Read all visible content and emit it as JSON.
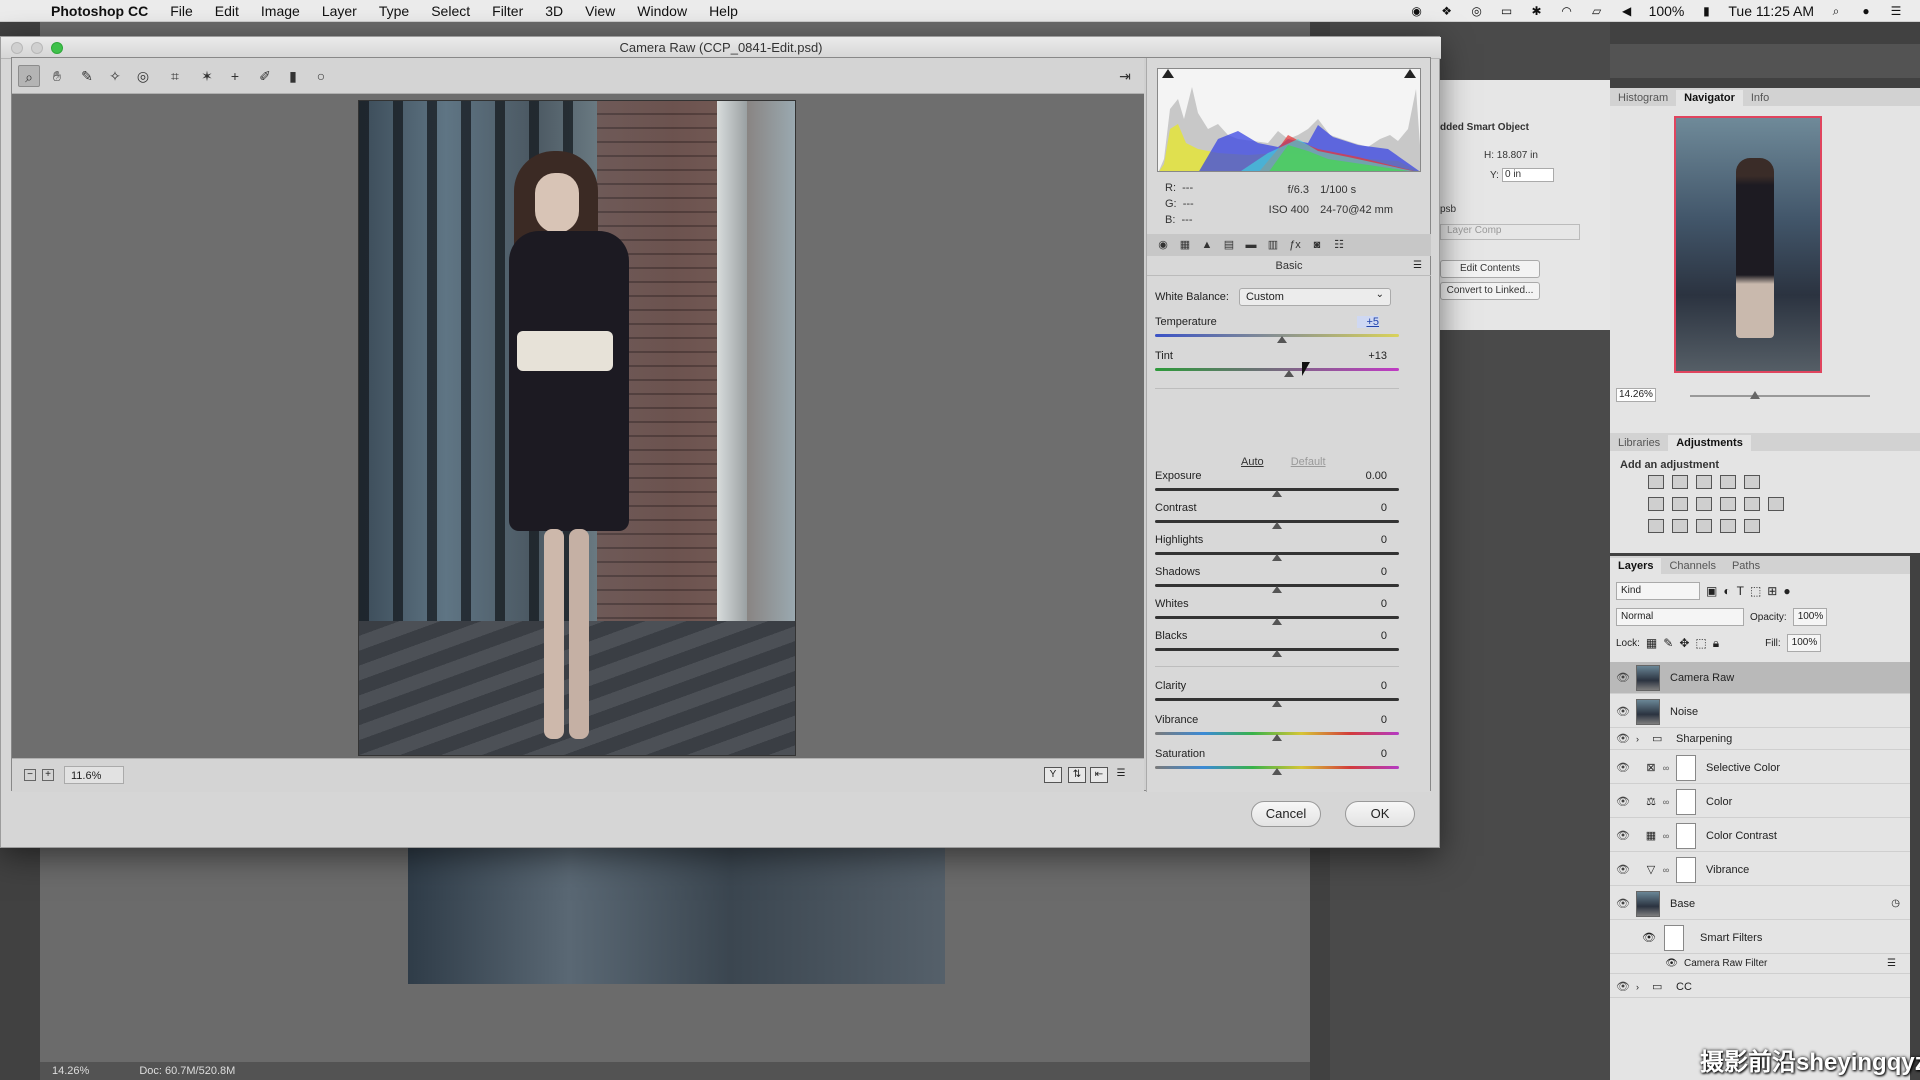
{
  "menubar": {
    "app_name": "Photoshop CC",
    "items": [
      "File",
      "Edit",
      "Image",
      "Layer",
      "Type",
      "Select",
      "Filter",
      "3D",
      "View",
      "Window",
      "Help"
    ],
    "battery": "100%",
    "clock": "Tue 11:25 AM"
  },
  "dialog": {
    "title": "Camera Raw (CCP_0841-Edit.psd)",
    "zoom": "11.6%",
    "histogram": {
      "r": "---",
      "g": "---",
      "b": "---",
      "aperture": "f/6.3",
      "shutter": "1/100 s",
      "iso": "ISO 400",
      "lens": "24-70@42 mm"
    },
    "panel_name": "Basic",
    "white_balance": {
      "label": "White Balance:",
      "value": "Custom"
    },
    "sliders": [
      {
        "label": "Temperature",
        "value": "+5",
        "fraction": 0.52
      },
      {
        "label": "Tint",
        "value": "+13",
        "fraction": 0.55
      },
      {
        "label": "Exposure",
        "value": "0.00",
        "fraction": 0.5
      },
      {
        "label": "Contrast",
        "value": "0",
        "fraction": 0.5
      },
      {
        "label": "Highlights",
        "value": "0",
        "fraction": 0.5
      },
      {
        "label": "Shadows",
        "value": "0",
        "fraction": 0.5
      },
      {
        "label": "Whites",
        "value": "0",
        "fraction": 0.5
      },
      {
        "label": "Blacks",
        "value": "0",
        "fraction": 0.5
      },
      {
        "label": "Clarity",
        "value": "0",
        "fraction": 0.5
      },
      {
        "label": "Vibrance",
        "value": "0",
        "fraction": 0.5
      },
      {
        "label": "Saturation",
        "value": "0",
        "fraction": 0.5
      }
    ],
    "auto_label": "Auto",
    "default_label": "Default",
    "cancel_label": "Cancel",
    "ok_label": "OK"
  },
  "properties": {
    "title_fragment": "dded Smart Object",
    "h": "H: 18.807 in",
    "y_label": "Y:",
    "y_value": "0 in",
    "ext": "psb",
    "layer_comp": "Layer Comp",
    "edit_contents": "Edit Contents",
    "convert": "Convert to Linked..."
  },
  "navigator": {
    "tabs": [
      "Histogram",
      "Navigator",
      "Info"
    ],
    "active_tab": "Navigator",
    "zoom": "14.26%"
  },
  "adjustments": {
    "tabs": [
      "Libraries",
      "Adjustments"
    ],
    "title": "Add an adjustment"
  },
  "layers": {
    "tabs": [
      "Layers",
      "Channels",
      "Paths"
    ],
    "kind": "Kind",
    "blend": "Normal",
    "opacity_label": "Opacity:",
    "opacity": "100%",
    "lock_label": "Lock:",
    "fill_label": "Fill:",
    "fill": "100%",
    "rows": [
      {
        "name": "Camera Raw",
        "type": "pixel",
        "selected": true
      },
      {
        "name": "Noise",
        "type": "pixel",
        "selected": false
      },
      {
        "name": "Sharpening",
        "type": "group",
        "selected": false
      },
      {
        "name": "Selective Color",
        "type": "adjustment",
        "icon": "selective-color-icon",
        "selected": false
      },
      {
        "name": "Color",
        "type": "adjustment",
        "icon": "color-balance-icon",
        "selected": false
      },
      {
        "name": "Color Contrast",
        "type": "adjustment",
        "icon": "curves-icon",
        "selected": false
      },
      {
        "name": "Vibrance",
        "type": "adjustment",
        "icon": "vibrance-icon",
        "selected": false
      },
      {
        "name": "Base",
        "type": "smart",
        "selected": false
      },
      {
        "name": "Smart Filters",
        "type": "smart-filters",
        "selected": false
      },
      {
        "name": "Camera Raw Filter",
        "type": "filter",
        "selected": false
      },
      {
        "name": "CC",
        "type": "group",
        "selected": false
      }
    ]
  },
  "status": {
    "zoom": "14.26%",
    "doc": "Doc: 60.7M/520.8M"
  },
  "watermark": "摄影前沿sheyingqyz.com"
}
